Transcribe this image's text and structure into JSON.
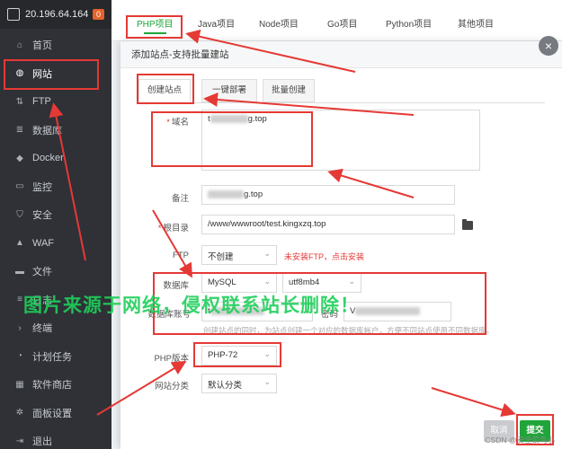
{
  "sidebar": {
    "ip": "20.196.64.164",
    "badge": "0",
    "items": [
      {
        "label": "首页",
        "icon": "home-icon"
      },
      {
        "label": "网站",
        "icon": "globe-icon"
      },
      {
        "label": "FTP",
        "icon": "ftp-icon"
      },
      {
        "label": "数据库",
        "icon": "database-icon"
      },
      {
        "label": "Docker",
        "icon": "docker-icon"
      },
      {
        "label": "监控",
        "icon": "monitor-icon"
      },
      {
        "label": "安全",
        "icon": "shield-icon"
      },
      {
        "label": "WAF",
        "icon": "waf-icon"
      },
      {
        "label": "文件",
        "icon": "folder-icon"
      },
      {
        "label": "日志",
        "icon": "log-icon"
      },
      {
        "label": "终端",
        "icon": "terminal-icon"
      },
      {
        "label": "计划任务",
        "icon": "clock-icon"
      },
      {
        "label": "软件商店",
        "icon": "store-icon"
      },
      {
        "label": "面板设置",
        "icon": "gear-icon"
      },
      {
        "label": "退出",
        "icon": "logout-icon"
      }
    ]
  },
  "topTabs": [
    "PHP项目",
    "Java项目",
    "Node项目",
    "Go项目",
    "Python项目",
    "其他项目"
  ],
  "modal": {
    "title": "添加站点-支持批量建站",
    "close": "×",
    "subtabs": [
      "创建站点",
      "一键部署",
      "批量创建"
    ],
    "domain": {
      "label": "域名",
      "value": "t",
      "value_suffix": "g.top"
    },
    "remark": {
      "label": "备注",
      "value_suffix": "g.top"
    },
    "root": {
      "label": "根目录",
      "value": "/www/wwwroot/test.kingxzq.top"
    },
    "ftp": {
      "label": "FTP",
      "value": "不创建",
      "hint": "未安装FTP，点击安装"
    },
    "database": {
      "label": "数据库",
      "type": "MySQL",
      "charset": "utf8mb4"
    },
    "dbaccount": {
      "label": "数据库账号",
      "value": "t",
      "pw_label": "密码",
      "pw_value": "V"
    },
    "db_hint": "创建站点的同时，为站点创建一个对应的数据库帐户，方便不同站点使用不同数据库。",
    "php": {
      "label": "PHP版本",
      "value": "PHP-72"
    },
    "category": {
      "label": "网站分类",
      "value": "默认分类"
    },
    "cancel": "取消",
    "submit": "提交"
  },
  "watermark": "图片来源于网络，侵权联系站长删除！",
  "credit": "CSDN @安全菜鸟小"
}
